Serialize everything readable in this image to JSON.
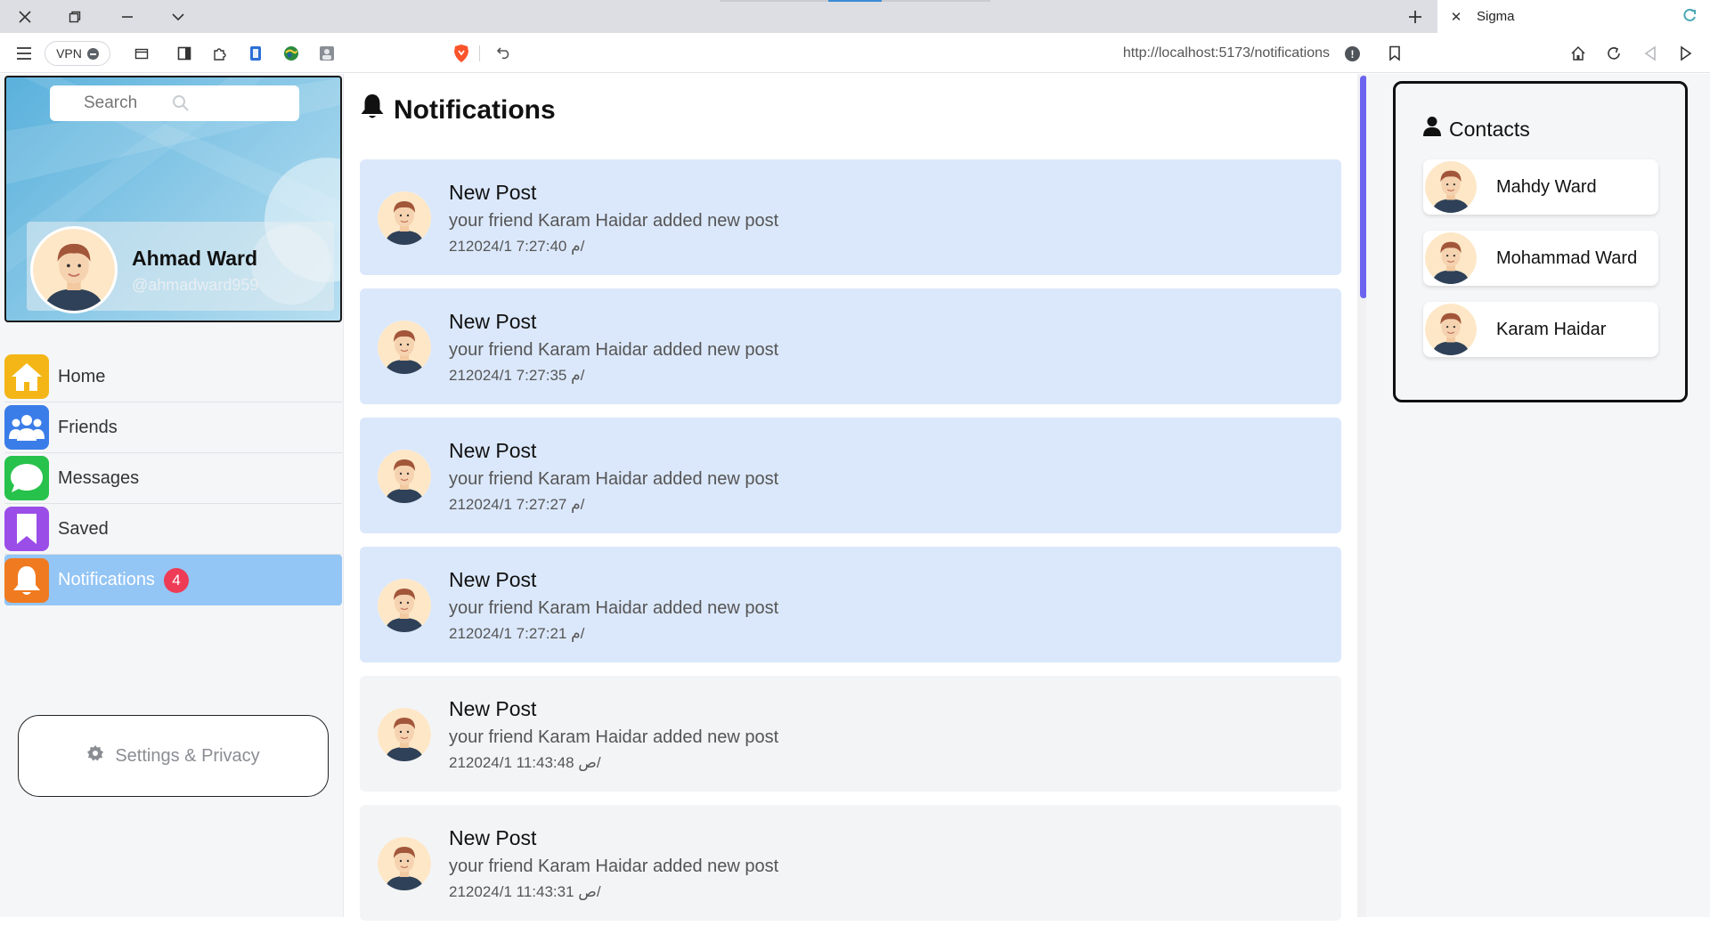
{
  "browser": {
    "tab_title": "Sigma",
    "vpn_label": "VPN",
    "url": "http://localhost:5173/notifications"
  },
  "sidebar": {
    "search_placeholder": "Search",
    "profile": {
      "name": "Ahmad Ward",
      "handle": "@ahmadward959"
    },
    "items": [
      {
        "label": "Home",
        "icon": "home-icon",
        "color": "#f4b616"
      },
      {
        "label": "Friends",
        "icon": "users-icon",
        "color": "#3b7de8"
      },
      {
        "label": "Messages",
        "icon": "chat-icon",
        "color": "#27c24c"
      },
      {
        "label": "Saved",
        "icon": "bookmark-icon",
        "color": "#9b4de8"
      },
      {
        "label": "Notifications",
        "icon": "bell-icon",
        "color": "#f07a20",
        "badge": "4"
      }
    ],
    "settings_label": "Settings & Privacy"
  },
  "main": {
    "title": "Notifications",
    "notifications": [
      {
        "title": "New Post",
        "body": "your friend Karam Haidar added new post",
        "time": "21م 7:27:40 2024/1/",
        "unread": true
      },
      {
        "title": "New Post",
        "body": "your friend Karam Haidar added new post",
        "time": "21م 7:27:35 2024/1/",
        "unread": true
      },
      {
        "title": "New Post",
        "body": "your friend Karam Haidar added new post",
        "time": "21م 7:27:27 2024/1/",
        "unread": true
      },
      {
        "title": "New Post",
        "body": "your friend Karam Haidar added new post",
        "time": "21م 7:27:21 2024/1/",
        "unread": true
      },
      {
        "title": "New Post",
        "body": "your friend Karam Haidar added new post",
        "time": "21ص 11:43:48 2024/1/",
        "unread": false
      },
      {
        "title": "New Post",
        "body": "your friend Karam Haidar added new post",
        "time": "21ص 11:43:31 2024/1/",
        "unread": false
      }
    ]
  },
  "contacts": {
    "title": "Contacts",
    "items": [
      {
        "name": "Mahdy Ward"
      },
      {
        "name": "Mohammad Ward"
      },
      {
        "name": "Karam Haidar"
      }
    ]
  },
  "colors": {
    "unread_bg": "#dbe8fb",
    "read_bg": "#f3f4f6",
    "active_nav": "#93c5f5",
    "badge": "#ee3b56",
    "scroll_thumb": "#6c63ef"
  }
}
